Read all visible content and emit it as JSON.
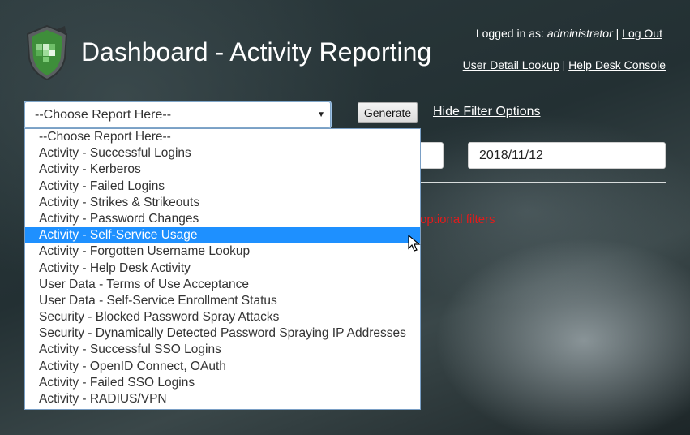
{
  "header": {
    "title": "Dashboard - Activity Reporting",
    "logged_in_prefix": "Logged in as:",
    "username": "administrator",
    "separator": "|",
    "logout_label": "Log Out",
    "user_detail_label": "User Detail Lookup",
    "help_desk_label": "Help Desk Console"
  },
  "controls": {
    "report_select_value": "--Choose Report Here--",
    "generate_label": "Generate",
    "hide_filter_label": "Hide Filter Options",
    "end_date": "2018/11/12",
    "optional_filters_text": "optional filters"
  },
  "dropdown": {
    "selected_index": 6,
    "options": [
      "--Choose Report Here--",
      "Activity - Successful Logins",
      "Activity - Kerberos",
      "Activity - Failed Logins",
      "Activity - Strikes & Strikeouts",
      "Activity - Password Changes",
      "Activity - Self-Service Usage",
      "Activity - Forgotten Username Lookup",
      "Activity - Help Desk Activity",
      "User Data - Terms of Use Acceptance",
      "User Data - Self-Service Enrollment Status",
      "Security - Blocked Password Spray Attacks",
      "Security - Dynamically Detected Password Spraying IP Addresses",
      "Activity - Successful SSO Logins",
      "Activity - OpenID Connect, OAuth",
      "Activity - Failed SSO Logins",
      "Activity - RADIUS/VPN"
    ]
  },
  "icons": {
    "logo": "shield-logo-icon",
    "dropdown_arrow": "dropdown-arrow-icon",
    "cursor": "mouse-pointer-icon"
  },
  "colors": {
    "selected_option_bg": "#1e90ff",
    "warning_text": "#e31b1b",
    "logo_green": "#3e8e3a"
  }
}
